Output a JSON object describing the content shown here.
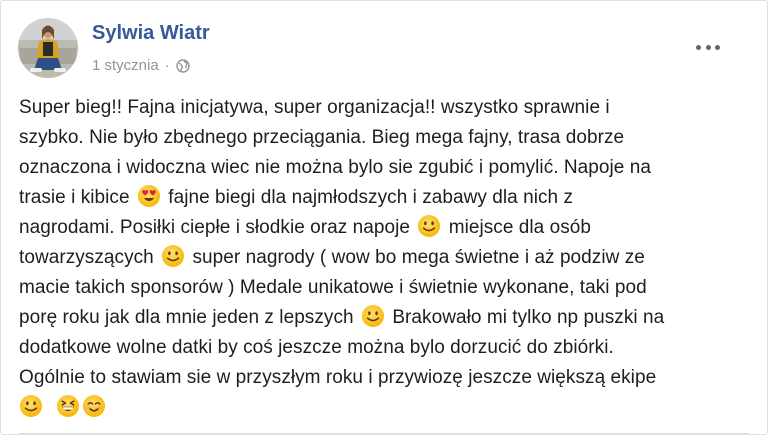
{
  "post": {
    "author": "Sylwia Wiatr",
    "date": "1 stycznia",
    "separator": "·",
    "privacy_icon": "globe-icon",
    "menu_icon": "more-options-icon",
    "text": {
      "l1": "Super bieg!! Fajna inicjatywa, super organizacja!! wszystko sprawnie i",
      "l2": "szybko. Nie było zbędnego przeciągania. Bieg mega fajny, trasa dobrze",
      "l3": "oznaczona i widoczna wiec nie można bylo sie zgubić i pomylić. Napoje na",
      "l4a": "trasie i kibice",
      "l4b": "fajne biegi dla najmłodszych i zabawy dla nich z",
      "l5a": "nagrodami. Posiłki ciepłe i słodkie oraz napoje",
      "l5b": "miejsce dla osób",
      "l6a": "towarzyszących",
      "l6b": "super nagrody ( wow bo mega świetne i aż podziw ze",
      "l7": "macie takich sponsorów ) Medale unikatowe i świetnie wykonane, taki pod",
      "l8a": "porę roku jak dla mnie jeden z lepszych",
      "l8b": "Brakowało mi tylko np puszki na",
      "l9": "dodatkowe wolne datki by coś jeszcze można bylo dorzucić do zbiórki.",
      "l10": "Ogólnie to stawiam sie w przyszłym roku i przywiozę jeszcze większą ekipe"
    },
    "emojis": {
      "heart_eyes": "heart-eyes-emoji",
      "smile": "slightly-smiling-face-emoji",
      "grin": "grinning-squinting-face-emoji",
      "blush": "smiling-face-with-smiling-eyes-emoji"
    }
  }
}
